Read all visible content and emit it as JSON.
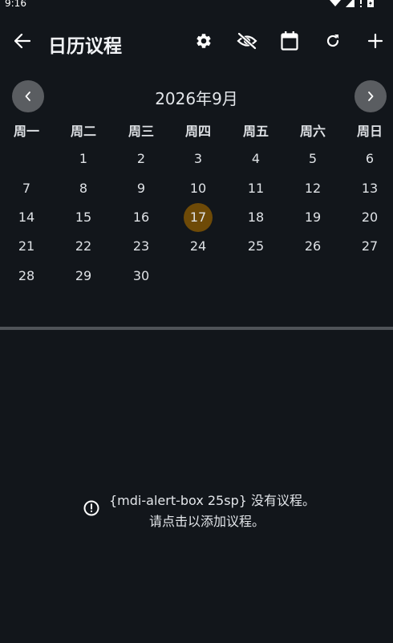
{
  "status_bar": {
    "time": "9:16",
    "icons": [
      "wifi-icon",
      "signal-icon",
      "no-sim-icon",
      "battery-icon"
    ]
  },
  "app_bar": {
    "title": "日历议程",
    "actions": [
      "settings-icon",
      "visibility-off-icon",
      "calendar-icon",
      "refresh-icon",
      "add-icon"
    ]
  },
  "calendar": {
    "month_label": "2026年9月",
    "weekdays": [
      "周一",
      "周二",
      "周三",
      "周四",
      "周五",
      "周六",
      "周日"
    ],
    "weeks": [
      [
        "",
        "1",
        "2",
        "3",
        "4",
        "5",
        "6"
      ],
      [
        "7",
        "8",
        "9",
        "10",
        "11",
        "12",
        "13"
      ],
      [
        "14",
        "15",
        "16",
        "17",
        "18",
        "19",
        "20"
      ],
      [
        "21",
        "22",
        "23",
        "24",
        "25",
        "26",
        "27"
      ],
      [
        "28",
        "29",
        "30",
        "",
        "",
        "",
        ""
      ]
    ],
    "today": "17",
    "today_color": "#6e4a07"
  },
  "empty_state": {
    "line1": "{mdi-alert-box 25sp} 没有议程。",
    "line2": "请点击以添加议程。",
    "icon": "alert-circle-icon"
  },
  "colors": {
    "background": "#12161b",
    "nav_button": "#5a5d61",
    "divider": "#4f5358"
  }
}
